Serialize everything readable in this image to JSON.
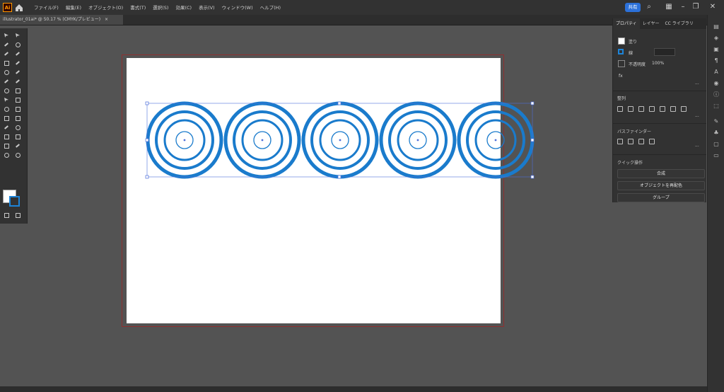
{
  "menubar": {
    "app_logo": "Ai",
    "menus": [
      "ファイル(F)",
      "編集(E)",
      "オブジェクト(O)",
      "書式(T)",
      "選択(S)",
      "効果(C)",
      "表示(V)",
      "ウィンドウ(W)",
      "ヘルプ(H)"
    ],
    "share_label": "共有"
  },
  "tab": {
    "document_title": "illustrator_01ai* @ 50.17 % (CMYK/プレビュー)"
  },
  "panel": {
    "tabs": [
      "プロパティ",
      "レイヤー",
      "CC ライブラリ"
    ],
    "appearance": {
      "fill_label": "塗り",
      "stroke_label": "線",
      "opacity_label": "不透明度",
      "opacity_value": "100%"
    },
    "align_title": "整列",
    "pathfinder_title": "パスファインダー",
    "quick_actions_title": "クイック操作",
    "buttons": [
      "合成",
      "オブジェクトを再配色",
      "グループ"
    ]
  },
  "colors": {
    "accent": "#2c71d9",
    "circle_stroke": "#1a7bcc",
    "artboard_border": "#8f3030"
  },
  "canvas": {
    "circle_count": 5,
    "ring_count": 4
  }
}
